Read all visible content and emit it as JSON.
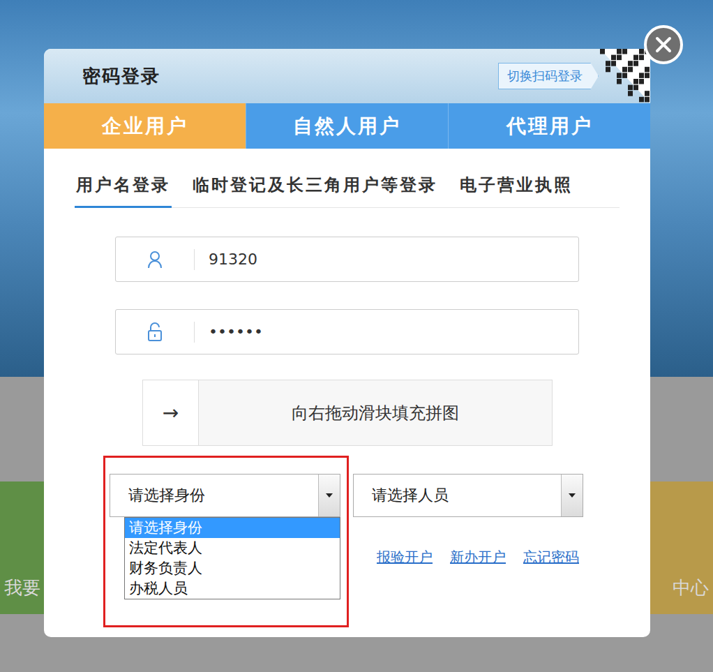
{
  "background": {
    "tiles": [
      {
        "label": "我要",
        "color": "#5f8f46"
      },
      {
        "label": "中心",
        "color": "#b89a4a"
      }
    ]
  },
  "dialog": {
    "title": "密码登录",
    "switch_button": "切换扫码登录"
  },
  "user_tabs": [
    {
      "label": "企业用户",
      "selected": true
    },
    {
      "label": "自然人用户",
      "selected": false
    },
    {
      "label": "代理用户",
      "selected": false
    }
  ],
  "login_tabs": [
    {
      "label": "用户名登录",
      "selected": true
    },
    {
      "label": "临时登记及长三角用户等登录",
      "selected": false
    },
    {
      "label": "电子营业执照",
      "selected": false
    }
  ],
  "fields": {
    "username": "91320",
    "password": "••••••"
  },
  "captcha": {
    "arrow": "→",
    "hint": "向右拖动滑块填充拼图"
  },
  "selects": [
    {
      "placeholder": "请选择身份",
      "open": true
    },
    {
      "placeholder": "请选择人员",
      "open": false
    }
  ],
  "dropdown": {
    "options": [
      {
        "label": "请选择身份",
        "selected": true
      },
      {
        "label": "法定代表人",
        "selected": false
      },
      {
        "label": "财务负责人",
        "selected": false
      },
      {
        "label": "办税人员",
        "selected": false
      }
    ]
  },
  "links": [
    "报验开户",
    "新办开户",
    "忘记密码"
  ],
  "annotation": {
    "color": "#e02020"
  }
}
